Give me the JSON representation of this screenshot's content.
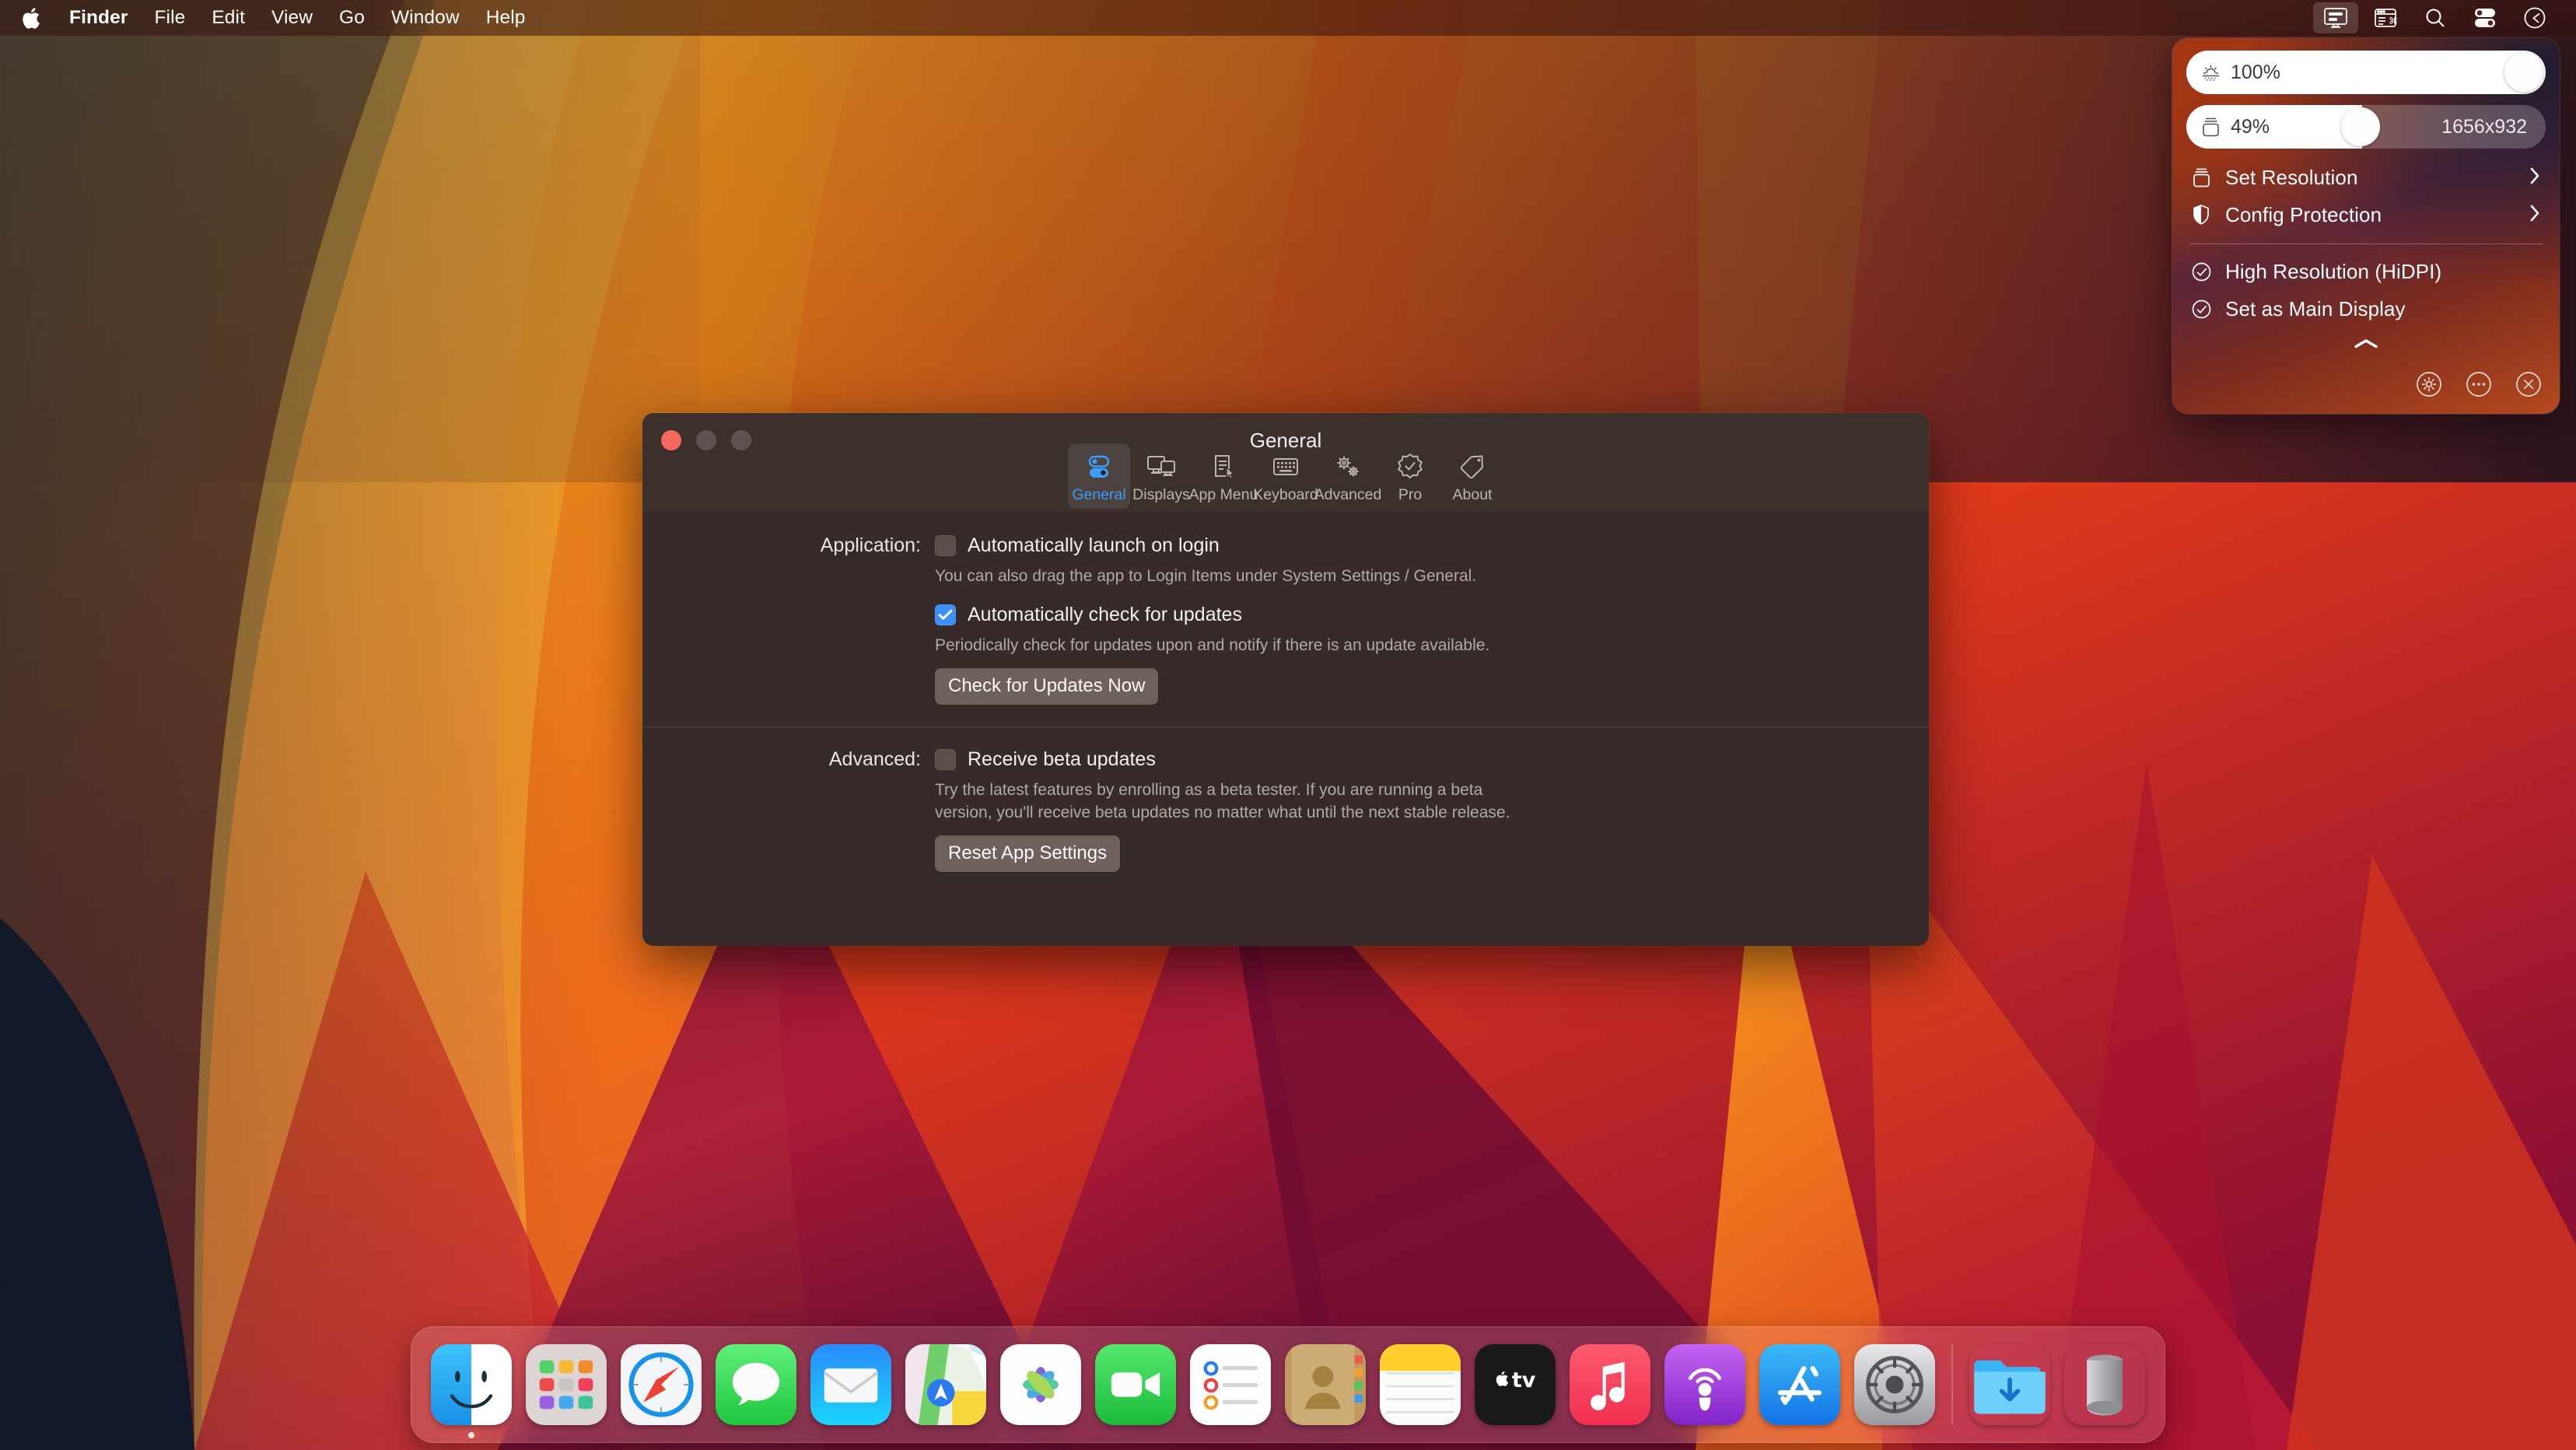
{
  "menubar": {
    "apple_icon": "apple-logo",
    "items": [
      {
        "label": "Finder",
        "bold": true
      },
      {
        "label": "File",
        "bold": false
      },
      {
        "label": "Edit",
        "bold": false
      },
      {
        "label": "View",
        "bold": false
      },
      {
        "label": "Go",
        "bold": false
      },
      {
        "label": "Window",
        "bold": false
      },
      {
        "label": "Help",
        "bold": false
      }
    ],
    "status_icons": [
      {
        "name": "display-menu-icon",
        "active": true
      },
      {
        "name": "shortcuts-window-icon",
        "active": false
      },
      {
        "name": "search-icon",
        "active": false
      },
      {
        "name": "control-center-icon",
        "active": false
      },
      {
        "name": "siri-clock-icon",
        "active": false
      }
    ]
  },
  "panel": {
    "brightness_slider": {
      "icon": "brightness-sun-icon",
      "value_label": "100%",
      "percent": 100
    },
    "resolution_slider": {
      "icon": "display-stack-icon",
      "value_label": "49%",
      "percent": 49,
      "right_label": "1656x932"
    },
    "menu_items": [
      {
        "label": "Set Resolution",
        "icon": "display-stack-icon",
        "chevron": "chevron-right-icon"
      },
      {
        "label": "Config Protection",
        "icon": "shield-half-icon",
        "chevron": "chevron-right-icon"
      }
    ],
    "toggle_items": [
      {
        "label": "High Resolution (HiDPI)",
        "icon": "check-circle-icon",
        "checked": true
      },
      {
        "label": "Set as Main Display",
        "icon": "check-circle-icon",
        "checked": true
      }
    ],
    "collapse_icon": "chevron-up-icon",
    "actions": [
      {
        "name": "settings-gear-button",
        "icon": "gear-circle-icon"
      },
      {
        "name": "more-options-button",
        "icon": "ellipsis-circle-icon"
      },
      {
        "name": "close-panel-button",
        "icon": "close-circle-icon"
      }
    ]
  },
  "window": {
    "title": "General",
    "traffic_lights": [
      {
        "name": "close-window-button",
        "color": "#f5685e"
      },
      {
        "name": "minimize-window-button",
        "color": "#5e5350"
      },
      {
        "name": "maximize-window-button",
        "color": "#5e5350"
      }
    ],
    "tabs": [
      {
        "label": "General",
        "icon": "toggles-icon",
        "selected": true
      },
      {
        "label": "Displays",
        "icon": "displays-icon",
        "selected": false
      },
      {
        "label": "App Menu",
        "icon": "app-menu-icon",
        "selected": false
      },
      {
        "label": "Keyboard",
        "icon": "keyboard-icon",
        "selected": false
      },
      {
        "label": "Advanced",
        "icon": "gears-icon",
        "selected": false
      },
      {
        "label": "Pro",
        "icon": "seal-check-icon",
        "selected": false
      },
      {
        "label": "About",
        "icon": "tag-icon",
        "selected": false
      }
    ],
    "application_section": {
      "label": "Application:",
      "launch_checkbox": {
        "label": "Automatically launch on login",
        "checked": false
      },
      "launch_help": "You can also drag the app to Login Items under System Settings / General.",
      "updates_checkbox": {
        "label": "Automatically check for updates",
        "checked": true
      },
      "updates_help": "Periodically check for updates upon and notify if there is an update available.",
      "check_button": "Check for Updates Now"
    },
    "advanced_section": {
      "label": "Advanced:",
      "beta_checkbox": {
        "label": "Receive beta updates",
        "checked": false
      },
      "beta_help": "Try the latest features by enrolling as a beta tester. If you are running a beta version, you'll receive beta updates no matter what until the next stable release.",
      "reset_button": "Reset App Settings"
    }
  },
  "dock": {
    "items": [
      {
        "name": "finder",
        "running": true
      },
      {
        "name": "launchpad",
        "running": false
      },
      {
        "name": "safari",
        "running": false
      },
      {
        "name": "messages",
        "running": false
      },
      {
        "name": "mail",
        "running": false
      },
      {
        "name": "maps",
        "running": false
      },
      {
        "name": "photos",
        "running": false
      },
      {
        "name": "facetime",
        "running": false
      },
      {
        "name": "reminders",
        "running": false
      },
      {
        "name": "contacts",
        "running": false
      },
      {
        "name": "notes",
        "running": false
      },
      {
        "name": "apple-tv",
        "running": false
      },
      {
        "name": "music",
        "running": false
      },
      {
        "name": "podcasts",
        "running": false
      },
      {
        "name": "app-store",
        "running": false
      },
      {
        "name": "system-settings",
        "running": false
      }
    ],
    "trailing": [
      {
        "name": "downloads-folder"
      },
      {
        "name": "trash"
      }
    ]
  },
  "colors": {
    "accent_blue": "#3d8ef7",
    "window_bg": "#362b28",
    "titlebar_bg": "#3b302c",
    "close_red": "#f5685e"
  }
}
